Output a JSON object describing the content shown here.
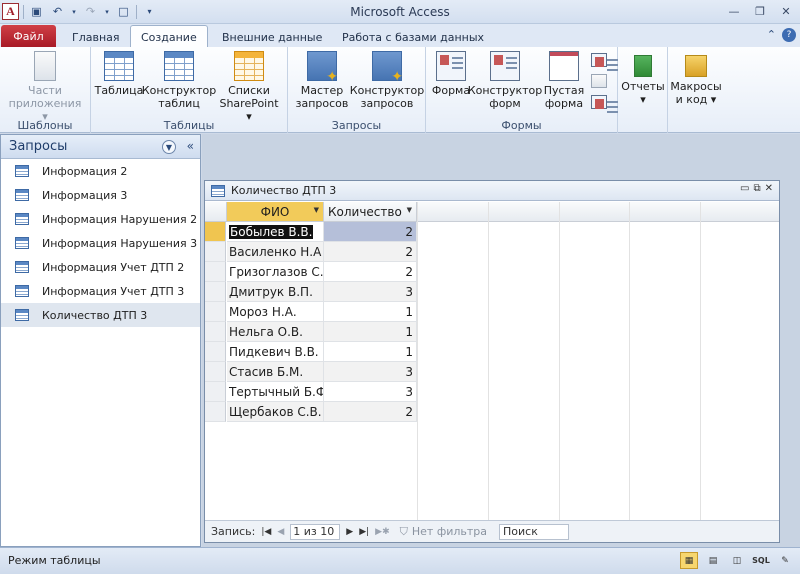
{
  "window": {
    "title": "Microsoft Access",
    "app_icon": "access-logo",
    "controls": [
      "minimize-icon",
      "restore-icon",
      "close-icon"
    ]
  },
  "ribbon_tabs": {
    "file": "Файл",
    "tabs": [
      "Главная",
      "Создание",
      "Внешние данные",
      "Работа с базами данных"
    ],
    "active": "Создание"
  },
  "ribbon": {
    "groups": [
      {
        "label": "Шаблоны",
        "buttons": [
          {
            "label": "Части\nприложения",
            "icon": "app-parts-icon",
            "disabled": true,
            "dropdown": true
          }
        ]
      },
      {
        "label": "Таблицы",
        "buttons": [
          {
            "label": "Таблица",
            "icon": "table-icon"
          },
          {
            "label": "Конструктор\nтаблиц",
            "icon": "table-design-icon"
          },
          {
            "label": "Списки\nSharePoint",
            "icon": "sharepoint-lists-icon",
            "dropdown": true
          }
        ]
      },
      {
        "label": "Запросы",
        "buttons": [
          {
            "label": "Мастер\nзапросов",
            "icon": "query-wizard-icon"
          },
          {
            "label": "Конструктор\nзапросов",
            "icon": "query-design-icon"
          }
        ]
      },
      {
        "label": "Формы",
        "buttons": [
          {
            "label": "Форма",
            "icon": "form-icon"
          },
          {
            "label": "Конструктор\nформ",
            "icon": "form-design-icon"
          },
          {
            "label": "Пустая\nформа",
            "icon": "blank-form-icon"
          }
        ]
      },
      {
        "label": "",
        "buttons": [
          {
            "label": "Отчеты",
            "icon": "reports-icon",
            "dropdown": true
          }
        ]
      },
      {
        "label": "",
        "buttons": [
          {
            "label": "Макросы\nи код",
            "icon": "macros-icon",
            "dropdown": true
          }
        ]
      }
    ]
  },
  "nav_pane": {
    "title": "Запросы",
    "items": [
      "Информация 2",
      "Информация 3",
      "Информация Нарушения 2",
      "Информация Нарушения 3",
      "Информация Учет ДТП 2",
      "Информация Учет ДТП 3",
      "Количество ДТП 3"
    ],
    "selected_index": 6
  },
  "document": {
    "title": "Количество ДТП 3",
    "columns": [
      "ФИО",
      "Количество"
    ],
    "rows": [
      {
        "fio": "Бобылев В.В.",
        "count": "2"
      },
      {
        "fio": "Василенко Н.А",
        "count": "2"
      },
      {
        "fio": "Гризоглазов С.",
        "count": "2"
      },
      {
        "fio": "Дмитрук В.П.",
        "count": "3"
      },
      {
        "fio": "Мороз Н.А.",
        "count": "1"
      },
      {
        "fio": "Нельга О.В.",
        "count": "1"
      },
      {
        "fio": "Пидкевич В.В.",
        "count": "1"
      },
      {
        "fio": "Стасив Б.М.",
        "count": "3"
      },
      {
        "fio": "Тертычный Б.Ф",
        "count": "3"
      },
      {
        "fio": "Щербаков С.В.",
        "count": "2"
      }
    ],
    "current_row": 0
  },
  "record_nav": {
    "label": "Запись:",
    "position": "1 из 10",
    "filter": "Нет фильтра",
    "search": "Поиск"
  },
  "status": {
    "text": "Режим таблицы",
    "views": [
      "datasheet-view-icon",
      "pivot-table-icon",
      "pivot-chart-icon",
      "SQL",
      "design-view-icon"
    ],
    "sql_label": "SQL"
  },
  "colors": {
    "file_tab": "#b82430",
    "selection": "#f2cb5a",
    "frame": "#cfd9e8"
  }
}
